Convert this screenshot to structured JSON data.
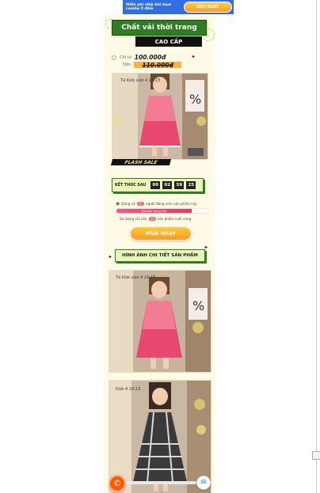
{
  "banner": {
    "text": "Miễn phí ship khi mua combo 5 đầm",
    "button": "ĐẶT NGAY"
  },
  "hero": {
    "title": "Chất vải thời trang",
    "subtitle": "CAO CẤP",
    "price_label": "Chỉ từ",
    "price": "100.000đ",
    "old_price_label": "Đến",
    "old_price": "110.000đ",
    "photo_caption": "Tả Kids size 4 16-15"
  },
  "flash_sale": {
    "label": "FLASH SALE"
  },
  "countdown": {
    "label": "KẾT THÚC SAU",
    "values": [
      "00",
      "02",
      "59",
      "25"
    ]
  },
  "viewers": {
    "prefix": "Đang có",
    "count": "25",
    "suffix": "người đang xem sản phẩm này"
  },
  "progress": {
    "label": "Đã bán hàng tồn",
    "fraction": 0.82
  },
  "stock": {
    "prefix": "Số lượng chỉ còn",
    "count": "40",
    "suffix": "sản phẩm cuối cùng"
  },
  "buy_button": "MUA NGAY",
  "detail": {
    "title": "HÌNH ẢNH CHI TIẾT SẢN PHẨM",
    "photo1_caption": "Tả Kids size 4 16-15",
    "photo2_caption": "Kids 4 16-15"
  },
  "colors": {
    "brand_green": "#2e7d24",
    "accent_orange": "#ff9a1e",
    "banner_blue": "#2f6fe0",
    "panel_bg": "#fffbe6"
  },
  "icons": [
    "phone-icon",
    "messenger-icon",
    "eye-icon",
    "sparkle-icon"
  ]
}
